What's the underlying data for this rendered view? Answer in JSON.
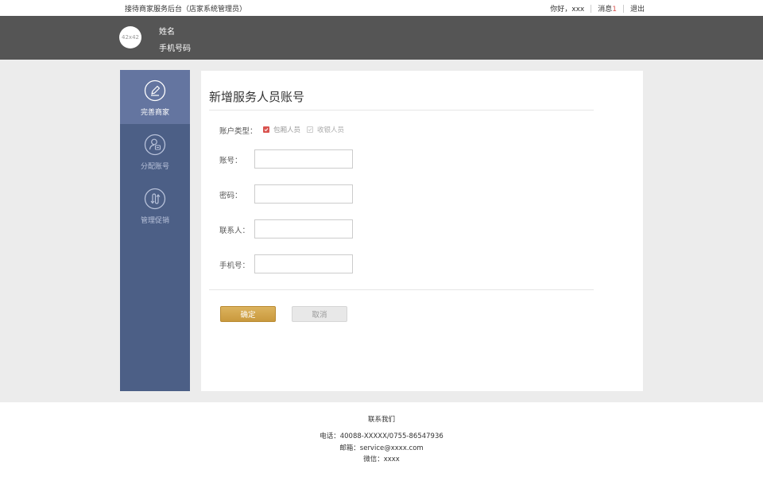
{
  "topbar": {
    "site_title": "接待商家服务后台（店家系统管理员）",
    "greeting": "你好，xxx",
    "messages_label": "消息",
    "messages_count": "1",
    "logout": "退出"
  },
  "header": {
    "avatar_text": "42x42",
    "name": "姓名",
    "phone": "手机号码"
  },
  "sidebar": {
    "items": [
      {
        "label": "完善商家",
        "icon": "pencil-icon",
        "active": true
      },
      {
        "label": "分配账号",
        "icon": "user-card-icon",
        "active": false
      },
      {
        "label": "管理促销",
        "icon": "exchange-arrows-icon",
        "active": false
      }
    ]
  },
  "form": {
    "title": "新增服务人员账号",
    "account_type_label": "账户类型：",
    "option_1": "包厢人员",
    "option_1_checked": true,
    "option_2": "收银人员",
    "option_2_checked": false,
    "account_label": "账号：",
    "account_value": "",
    "password_label": "密码：",
    "password_value": "",
    "contact_label": "联系人：",
    "contact_value": "",
    "phone_label": "手机号：",
    "phone_value": "",
    "confirm": "确定",
    "cancel": "取消"
  },
  "footer": {
    "contact_title": "联系我们",
    "tel": "电话：40088-XXXXX/0755-86547936",
    "email": "邮箱：service@xxxx.com",
    "wechat": "微信：xxxx"
  },
  "colors": {
    "sidebar": "#4c5f86",
    "sidebar_active": "#6475a0",
    "header": "#555555",
    "confirm_button": "#c9993d",
    "checkbox_checked": "#d9534f"
  }
}
